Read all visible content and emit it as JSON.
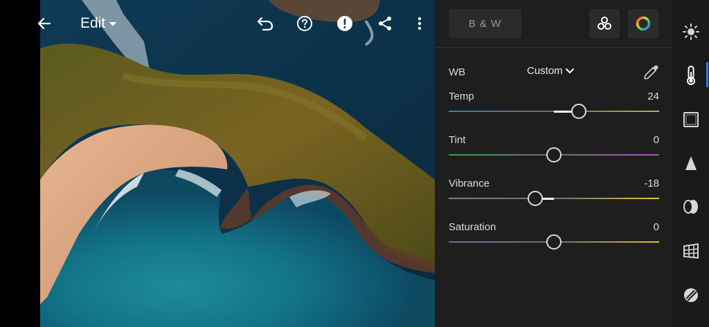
{
  "header": {
    "edit_label": "Edit",
    "icons": [
      "back-arrow-icon",
      "undo-icon",
      "help-icon",
      "alert-icon",
      "share-icon",
      "more-vertical-icon"
    ]
  },
  "panel": {
    "bw_label": "B & W",
    "wb": {
      "label": "WB",
      "value": "Custom"
    },
    "sliders": [
      {
        "label": "Temp",
        "value": "24",
        "position": 0.62,
        "track": [
          "#3f7fb8",
          "#b9b04a"
        ]
      },
      {
        "label": "Tint",
        "value": "0",
        "position": 0.5,
        "track": [
          "#3f9b4a",
          "#a65bb5"
        ]
      },
      {
        "label": "Vibrance",
        "value": "-18",
        "position": 0.41,
        "track": [
          "#7d7d9a",
          "#e7c53a"
        ]
      },
      {
        "label": "Saturation",
        "value": "0",
        "position": 0.5,
        "track": [
          "#7a6aa8",
          "#e8b938"
        ]
      }
    ]
  },
  "toolbar": {
    "tools": [
      "light-icon",
      "color-temperature-icon",
      "crop-icon",
      "detail-icon",
      "optics-icon",
      "geometry-icon",
      "presets-icon"
    ],
    "active_color": "#2f7df6"
  }
}
